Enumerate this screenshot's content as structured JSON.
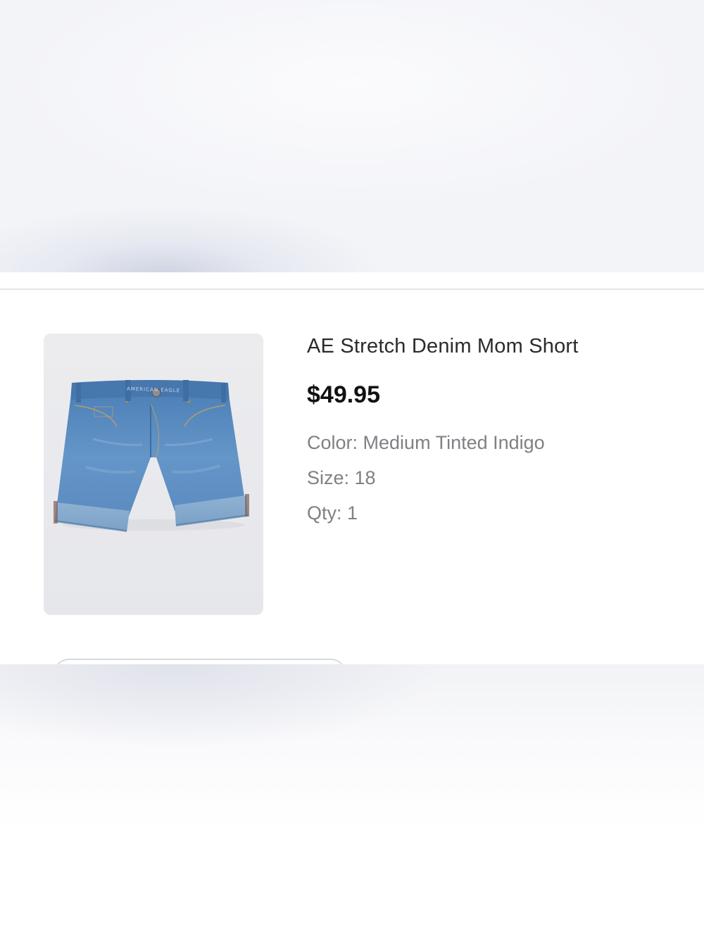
{
  "product": {
    "title": "AE Stretch Denim Mom Short",
    "price": "$49.95",
    "image_alt": "denim-shorts-product-image",
    "attributes": [
      {
        "label": "Color: ",
        "value": "Medium Tinted Indigo"
      },
      {
        "label": "Size: ",
        "value": "18"
      },
      {
        "label": "Qty: ",
        "value": "1"
      }
    ],
    "brand_mark": "AMERICAN EAGLE"
  },
  "colors": {
    "denim": "#5b8fc4",
    "background": "#ffffff",
    "divider": "#e4e5e9"
  }
}
